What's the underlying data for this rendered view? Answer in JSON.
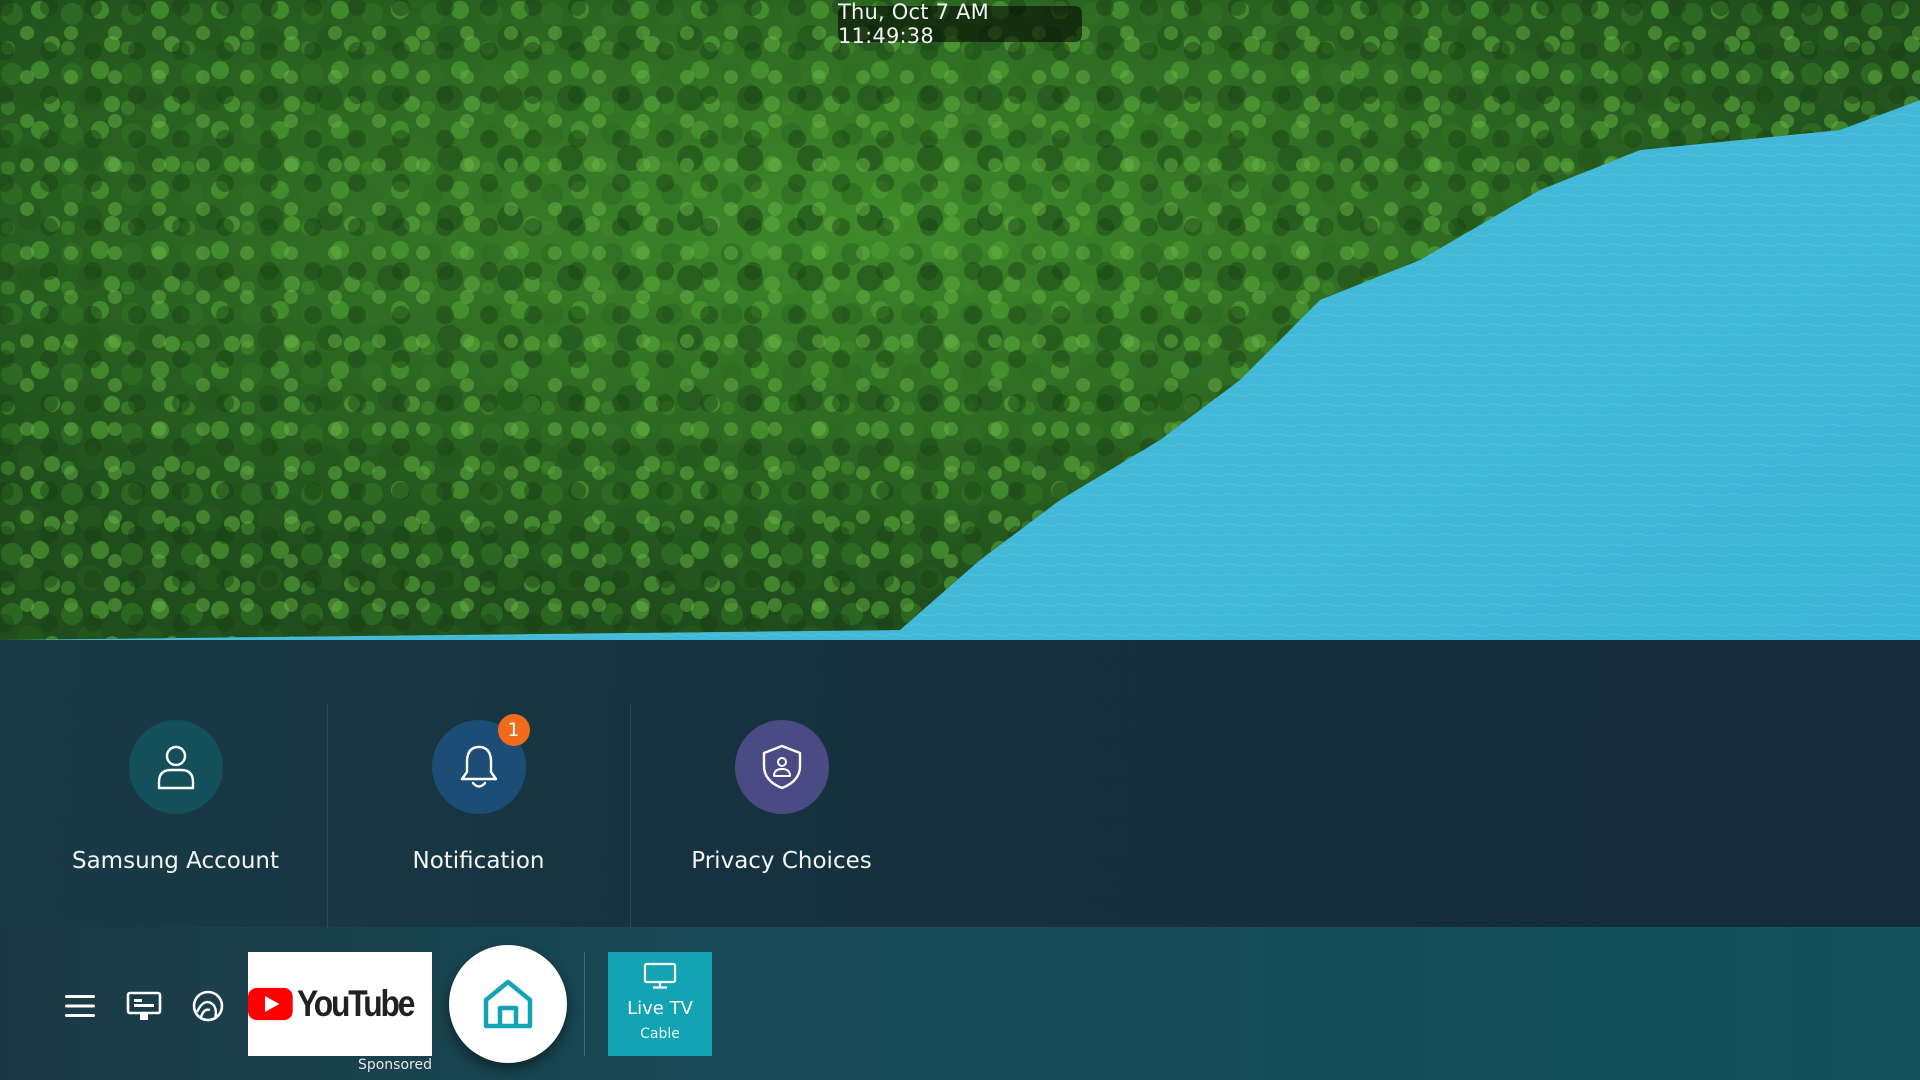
{
  "clock": {
    "text": "Thu, Oct 7 AM 11:49:38"
  },
  "settings_panel": {
    "tiles": [
      {
        "label": "Samsung Account",
        "icon": "person-icon",
        "color": "#13505a"
      },
      {
        "label": "Notification",
        "icon": "bell-icon",
        "color": "#1c4d77",
        "badge": "1",
        "badge_color": "#f26a1b"
      },
      {
        "label": "Privacy Choices",
        "icon": "shield-person-icon",
        "color": "#4a4a84"
      }
    ]
  },
  "bottom_bar": {
    "nav_icons": [
      "menu-icon",
      "source-icon",
      "ambient-icon"
    ],
    "featured_app": {
      "name": "YouTube",
      "caption": "Sponsored",
      "brand_color": "#ff0000"
    },
    "home": {
      "icon": "home-icon",
      "accent": "#12a4b4"
    },
    "live_tv": {
      "title": "Live TV",
      "subtitle": "Cable",
      "icon": "tv-icon",
      "color": "#12a4b4"
    }
  }
}
